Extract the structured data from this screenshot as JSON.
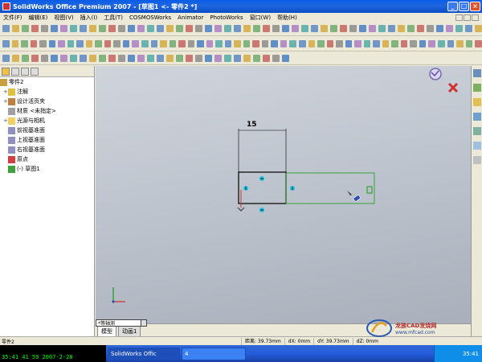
{
  "window": {
    "title": "SolidWorks Office Premium 2007 - [草图1 <- 零件2 *]"
  },
  "menu": [
    "文件(F)",
    "编辑(E)",
    "视图(V)",
    "插入(I)",
    "工具(T)",
    "COSMOSWorks",
    "Animator",
    "PhotoWorks",
    "窗口(W)",
    "帮助(H)"
  ],
  "feature_tree": {
    "root": "零件2",
    "items": [
      {
        "label": "注解",
        "icon": "annotation-icon"
      },
      {
        "label": "设计活页夹",
        "icon": "binder-icon"
      },
      {
        "label": "材质 <未指定>",
        "icon": "material-icon"
      },
      {
        "label": "光源与相机",
        "icon": "lights-icon"
      },
      {
        "label": "前视基准面",
        "icon": "plane-icon"
      },
      {
        "label": "上视基准面",
        "icon": "plane-icon"
      },
      {
        "label": "右视基准面",
        "icon": "plane-icon"
      },
      {
        "label": "原点",
        "icon": "origin-icon"
      },
      {
        "label": "(-) 草图1",
        "icon": "sketch-icon"
      }
    ]
  },
  "sketch": {
    "dimension": "15"
  },
  "bottom": {
    "popup": "*等轴测",
    "tabs": [
      "模型",
      "动画1"
    ]
  },
  "status": {
    "left": "零件2",
    "distance": "距离: 39.73mm",
    "dx": "dX: 0mm",
    "dy": "dY: 39.73mm",
    "dz": "dZ: 0mm"
  },
  "taskbar": {
    "left_clock": "35:41 41  59 2007-2-28",
    "tasks": [
      "SolidWorks Offic",
      "4"
    ],
    "time": "35:41"
  },
  "watermark": {
    "name": "龙族CAD发烧网",
    "url": "www.mfcad.com"
  },
  "colors": {
    "sketch_green": "#1a9a1a",
    "constraint_cyan": "#20c0e0",
    "dim_black": "#000000"
  }
}
